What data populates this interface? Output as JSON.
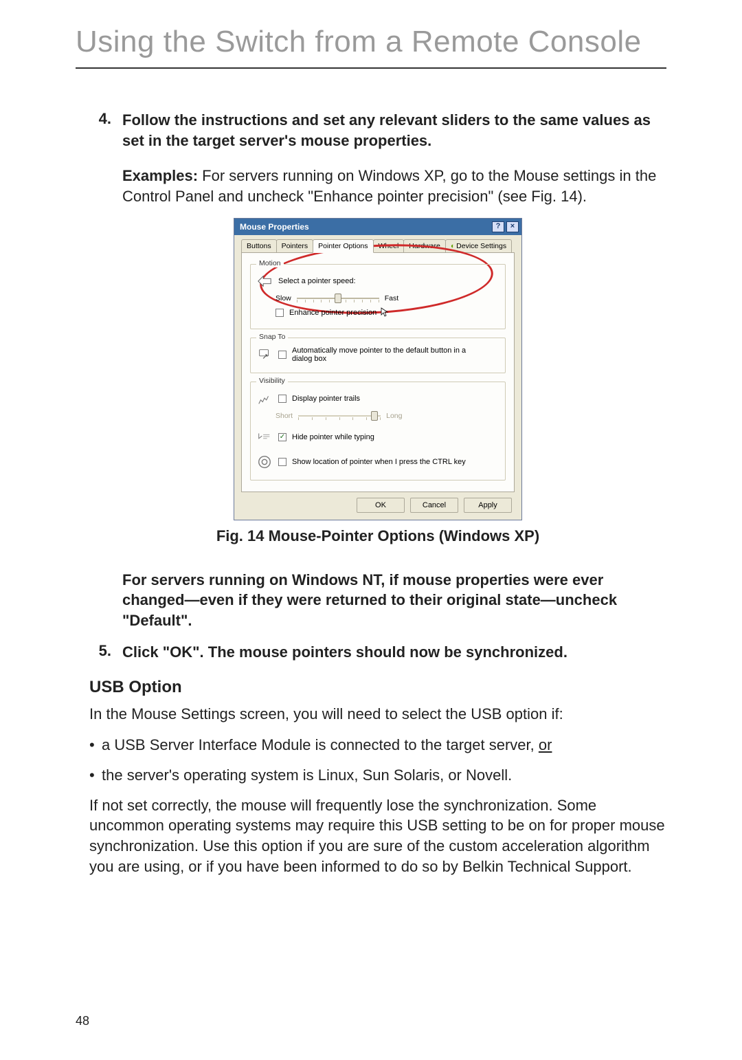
{
  "title": "Using the Switch from a Remote Console",
  "steps": {
    "s4": {
      "num": "4.",
      "text": "Follow the instructions and set any relevant sliders to the same values as set in the target server's mouse properties."
    },
    "s5": {
      "num": "5.",
      "text": "Click \"OK\". The mouse pointers should now be synchronized."
    }
  },
  "examples_label": "Examples:",
  "examples_text": " For servers running on Windows XP, go to the Mouse settings in the Control Panel and uncheck \"Enhance pointer precision\" (see Fig. 14).",
  "dialog": {
    "title": "Mouse Properties",
    "help": "?",
    "close": "×",
    "tabs": {
      "buttons": "Buttons",
      "pointers": "Pointers",
      "pointer_options": "Pointer Options",
      "wheel": "Wheel",
      "hardware": "Hardware",
      "device_settings": "Device Settings"
    },
    "motion": {
      "legend": "Motion",
      "label": "Select a pointer speed:",
      "slow": "Slow",
      "fast": "Fast",
      "enhance": "Enhance pointer precision"
    },
    "snap": {
      "legend": "Snap To",
      "label": "Automatically move pointer to the default button in a dialog box"
    },
    "visibility": {
      "legend": "Visibility",
      "trails": "Display pointer trails",
      "short": "Short",
      "long": "Long",
      "hide": "Hide pointer while typing",
      "ctrl": "Show location of pointer when I press the CTRL key"
    },
    "buttons": {
      "ok": "OK",
      "cancel": "Cancel",
      "apply": "Apply"
    }
  },
  "fig_caption": "Fig. 14 Mouse-Pointer Options (Windows XP)",
  "nt_text": "For servers running on Windows NT, if mouse properties were ever changed—even if they were returned to their original state—uncheck \"Default\".",
  "usb_heading": "USB Option",
  "usb_intro": "In the Mouse Settings screen, you will need to select the USB option if:",
  "usb_b1_pre": "a USB Server Interface Module is connected to the target server, ",
  "usb_b1_tail": "or",
  "usb_b2": "the server's operating system is Linux, Sun Solaris, or Novell.",
  "usb_para": "If not set correctly, the mouse will frequently lose the synchronization. Some uncommon operating systems may require this USB setting to be on for proper mouse synchronization. Use this option if you are sure of the custom acceleration algorithm you are using, or if you have been informed to do so by Belkin Technical Support.",
  "page_number": "48"
}
